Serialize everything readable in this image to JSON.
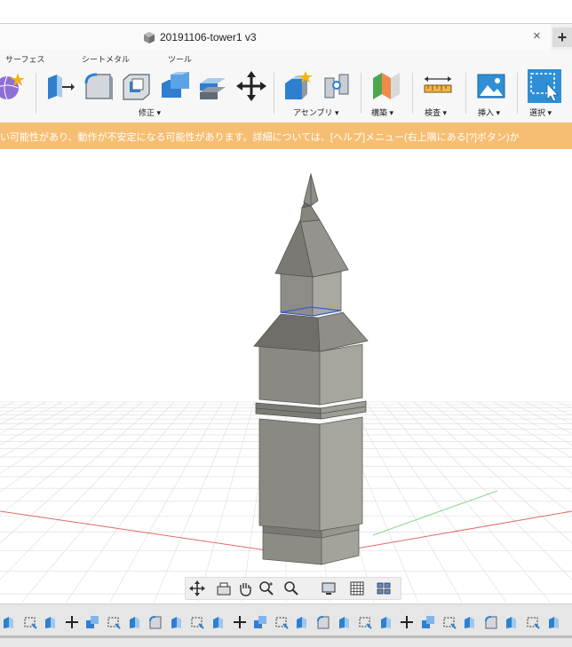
{
  "tab": {
    "title": "20191106-tower1 v3",
    "close": "×",
    "plus": "+"
  },
  "ribbon": {
    "tabs": [
      "サーフェス",
      "シートメタル",
      "ツール"
    ],
    "groups": {
      "modify": "修正 ▾",
      "assemble": "アセンブリ ▾",
      "construct": "構築 ▾",
      "inspect": "検査 ▾",
      "insert": "挿入 ▾",
      "select": "選択 ▾"
    }
  },
  "warning": {
    "text": "い可能性があり、動作が不安定になる可能性があります。詳細については、[ヘルプ]メニュー(右上隅にある[?]ボタン)か"
  },
  "colors": {
    "warning": "#f6be72",
    "select_blue": "#2f8fd6",
    "tower": "#8b8b85"
  },
  "navbar_icons": [
    "orbit-icon",
    "look-at-icon",
    "pan-icon",
    "zoom-icon",
    "fit-icon",
    "display-icon",
    "grid-icon",
    "viewports-icon"
  ],
  "timeline_icon_count": 27
}
